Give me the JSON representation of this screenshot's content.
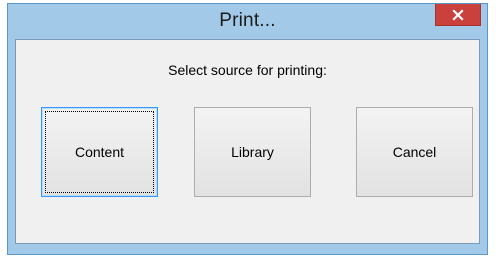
{
  "dialog": {
    "title": "Print...",
    "close_icon": "close-icon",
    "prompt": "Select source for printing:"
  },
  "buttons": {
    "content_label": "Content",
    "library_label": "Library",
    "cancel_label": "Cancel"
  },
  "colors": {
    "titlebar": "#a3c9e8",
    "close_button": "#c9403c",
    "client_background": "#f0f0f0",
    "default_button_border": "#3399ff"
  }
}
